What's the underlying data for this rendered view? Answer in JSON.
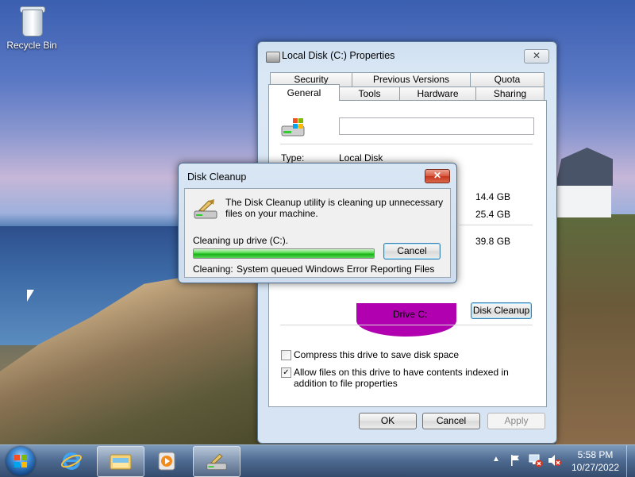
{
  "desktop": {
    "recycle_bin_label": "Recycle Bin"
  },
  "properties": {
    "title": "Local Disk (C:) Properties",
    "close_glyph": "✕",
    "tabs_row1": [
      "Security",
      "Previous Versions",
      "Quota"
    ],
    "tabs_row2": [
      "General",
      "Tools",
      "Hardware",
      "Sharing"
    ],
    "active_tab": "General",
    "type_label": "Type:",
    "type_value": "Local Disk",
    "used_space": "14.4 GB",
    "free_space": "25.4 GB",
    "capacity": "39.8 GB",
    "drive_label": "Drive C:",
    "disk_cleanup_label": "Disk Cleanup",
    "compress_label": "Compress this drive to save disk space",
    "compress_checked": false,
    "index_label": "Allow files on this drive to have contents indexed in addition to file properties",
    "index_checked": true,
    "ok_label": "OK",
    "cancel_label": "Cancel",
    "apply_label": "Apply",
    "pie_color": "#b000b0"
  },
  "cleanup_dialog": {
    "title": "Disk Cleanup",
    "close_glyph": "✕",
    "message": "The Disk Cleanup utility is cleaning up unnecessary files on your machine.",
    "status_label": "Cleaning up drive  (C:).",
    "progress_fraction": 1.0,
    "cancel_label": "Cancel",
    "cleaning_label": "Cleaning:",
    "cleaning_item": "System queued Windows Error Reporting Files"
  },
  "taskbar": {
    "time": "5:58 PM",
    "date": "10/27/2022",
    "tray_chevron": "▲"
  }
}
